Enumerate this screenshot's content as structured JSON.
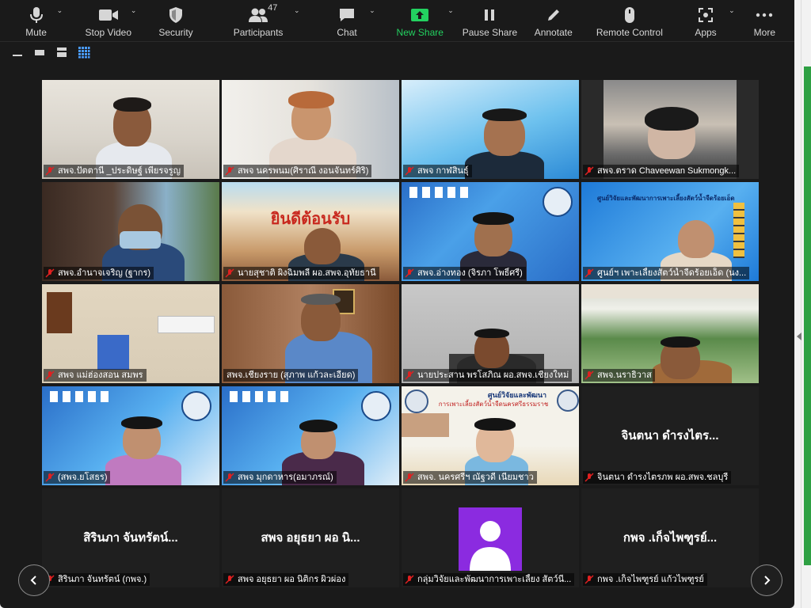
{
  "toolbar": {
    "mute": "Mute",
    "stop_video": "Stop Video",
    "security": "Security",
    "participants": "Participants",
    "participants_count": "47",
    "chat": "Chat",
    "new_share": "New Share",
    "pause_share": "Pause Share",
    "annotate": "Annotate",
    "remote_control": "Remote Control",
    "apps": "Apps",
    "more": "More"
  },
  "tiles": [
    {
      "name": "สพจ.ปัตตานี _ประดิษฐ์ เพียรจรูญ"
    },
    {
      "name": "สพจ นครพนม(ศิราณี งอนจันทร์ศิริ)"
    },
    {
      "name": "สพจ กาฬสินธุ์"
    },
    {
      "name": "สพจ.ตราด Chaveewan Sukmongk..."
    },
    {
      "name": "สพจ.อำนาจเจริญ (ฐากร)"
    },
    {
      "name": "นายสุชาติ ผิงฉิมพลี ผอ.สพจ.อุทัยธานี"
    },
    {
      "name": "สพจ.อ่างทอง (จิรภา โพธิ์ศรี)"
    },
    {
      "name": "ศูนย์ฯ เพาะเลี้ยงสัตว์น้ำจืดร้อยเอ็ด (นง..."
    },
    {
      "name": "สพจ แม่ฮ่องสอน สมพร"
    },
    {
      "name": "สพจ.เชียงราย (สุภาพ แก้วละเอียด)"
    },
    {
      "name": "นายประสาน พรโสภิณ ผอ.สพจ.เชียงใหม่"
    },
    {
      "name": "สพจ.นราธิวาส"
    },
    {
      "name": "(สพจ.ยโสธร)"
    },
    {
      "name": "สพจ มุกดาหาร(อมาภรณ์)"
    },
    {
      "name": "สพจ. นครศรีฯ ณัฐวดี เนี่ยมชาว"
    },
    {
      "name": "จินตนา ดำรงไตรภพ ผอ.สพจ.ชลบุรี",
      "big": "จินตนา ดำรงไตร..."
    },
    {
      "name": "สิรินภา จันทรัตน์ (กพจ.)",
      "big": "สิรินภา จันทรัตน์..."
    },
    {
      "name": "สพจ อยุธยา ผอ นิติกร ผิวผ่อง",
      "big": "สพจ อยุธยา ผอ นิ..."
    },
    {
      "name": "กลุ่มวิจัยและพัฒนาการเพาะเลี้ยง สัตว์นี่..."
    },
    {
      "name": "กพจ .เก็จไพฑูรย์ แก้วไพฑูรย์",
      "big": "กพจ .เก็จไพฑูรย์..."
    }
  ],
  "banners": {
    "row2_col2": "ยินดีต้อนรับ",
    "row4_col3_title": "ศูนย์วิจัยและพัฒนา",
    "row4_col3_sub": "การเพาะเลี้ยงสัตว์น้ำจืดนครศรีธรรมราช",
    "row2_col4": "ศูนย์วิจัยและพัฒนาการเพาะเลี้ยงสัตว์น้ำจืดร้อยเอ็ด"
  },
  "colors": {
    "toolbar_bg": "#1a1a1a",
    "share_green": "#23d160",
    "active_speaker": "#c9e26a",
    "muted_red": "#e02020"
  }
}
